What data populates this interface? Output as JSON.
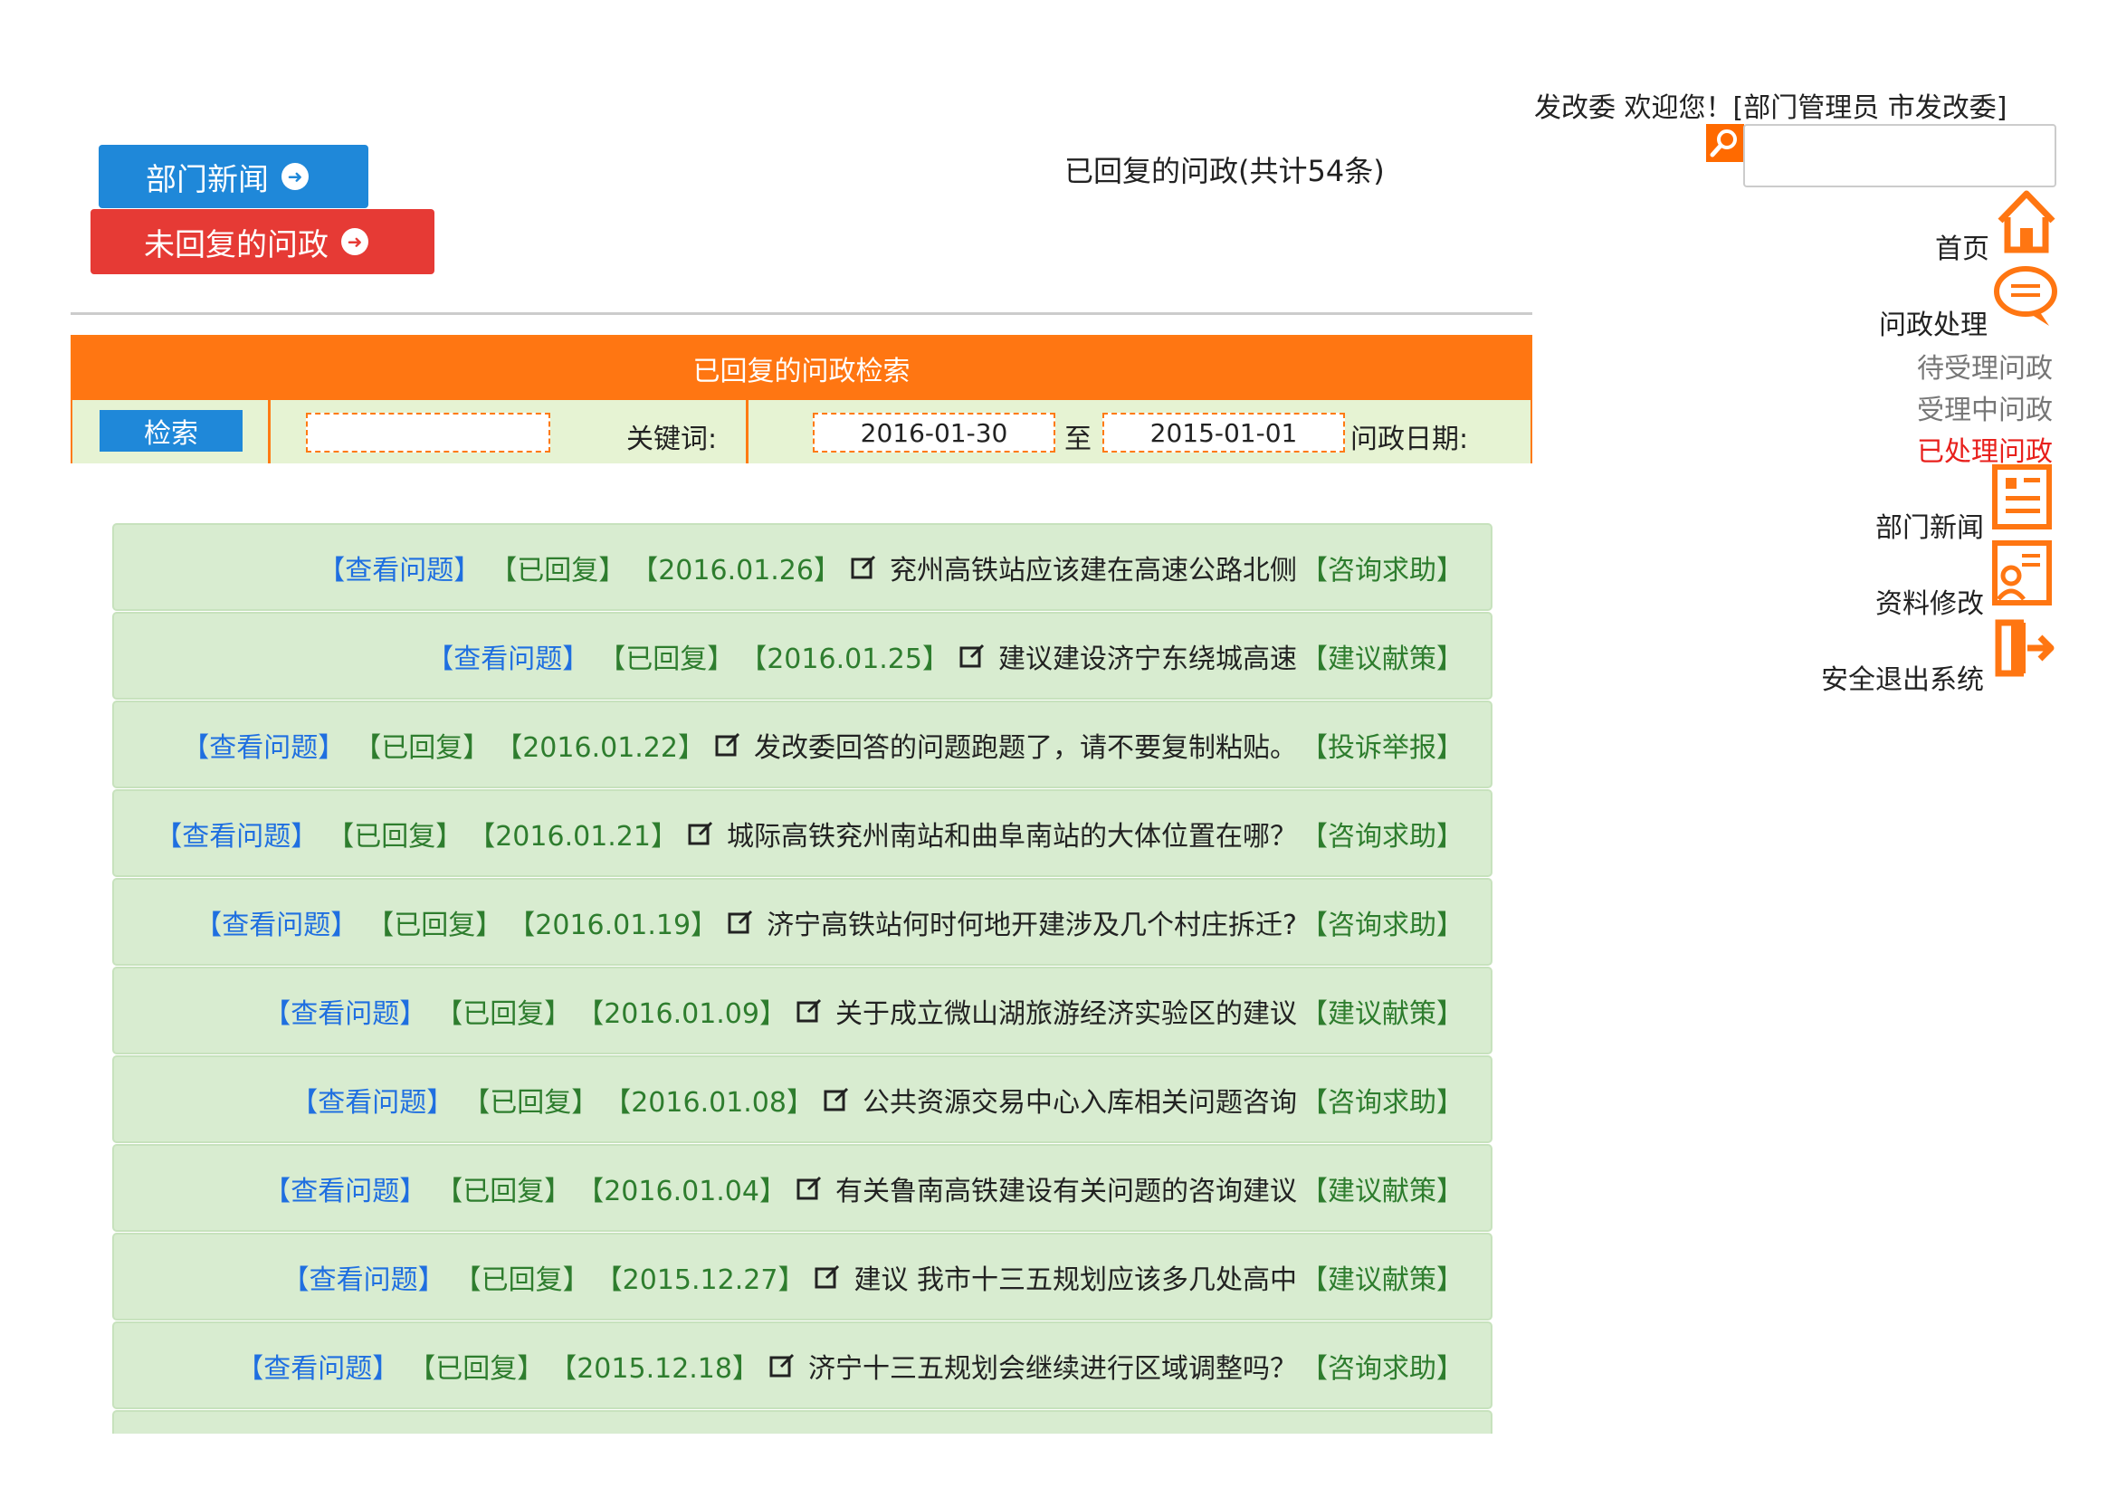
{
  "header": {
    "welcome": "发改委 欢迎您！[部门管理员 市发改委]",
    "search_placeholder": ""
  },
  "top_buttons": {
    "dept_news": "部门新闻",
    "unreplied": "未回复的问政"
  },
  "count_title": "已回复的问政(共计54条)",
  "panel": {
    "title": "已回复的问政检索",
    "date_label": "问政日期:",
    "date_from": "2015-01-01",
    "date_sep": "至",
    "date_to": "2016-01-30",
    "keyword_label": "关键词:",
    "keyword_value": "",
    "search_button": "检索"
  },
  "list": [
    {
      "category": "【咨询求助】",
      "title": "兖州高铁站应该建在高速公路北侧",
      "date": "【2016.01.26】",
      "status": "【已回复】",
      "action": "【查看问题】"
    },
    {
      "category": "【建议献策】",
      "title": "建议建设济宁东绕城高速",
      "date": "【2016.01.25】",
      "status": "【已回复】",
      "action": "【查看问题】"
    },
    {
      "category": "【投诉举报】",
      "title": "发改委回答的问题跑题了，请不要复制粘贴。",
      "date": "【2016.01.22】",
      "status": "【已回复】",
      "action": "【查看问题】"
    },
    {
      "category": "【咨询求助】",
      "title": "城际高铁兖州南站和曲阜南站的大体位置在哪？",
      "date": "【2016.01.21】",
      "status": "【已回复】",
      "action": "【查看问题】"
    },
    {
      "category": "【咨询求助】",
      "title": "济宁高铁站何时何地开建涉及几个村庄拆迁?",
      "date": "【2016.01.19】",
      "status": "【已回复】",
      "action": "【查看问题】"
    },
    {
      "category": "【建议献策】",
      "title": "关于成立微山湖旅游经济实验区的建议",
      "date": "【2016.01.09】",
      "status": "【已回复】",
      "action": "【查看问题】"
    },
    {
      "category": "【咨询求助】",
      "title": "公共资源交易中心入库相关问题咨询",
      "date": "【2016.01.08】",
      "status": "【已回复】",
      "action": "【查看问题】"
    },
    {
      "category": "【建议献策】",
      "title": "有关鲁南高铁建设有关问题的咨询建议",
      "date": "【2016.01.04】",
      "status": "【已回复】",
      "action": "【查看问题】"
    },
    {
      "category": "【建议献策】",
      "title": "建议 我市十三五规划应该多几处高中",
      "date": "【2015.12.27】",
      "status": "【已回复】",
      "action": "【查看问题】"
    },
    {
      "category": "【咨询求助】",
      "title": "济宁十三五规划会继续进行区域调整吗？",
      "date": "【2015.12.18】",
      "status": "【已回复】",
      "action": "【查看问题】"
    }
  ],
  "sidebar": {
    "home": "首页",
    "affairs": "问政处理",
    "pending": "待受理问政",
    "processing": "受理中问政",
    "done": "已处理问政",
    "news": "部门新闻",
    "profile": "资料修改",
    "logout": "安全退出系统"
  },
  "colors": {
    "accent_orange": "#ff7612",
    "blue": "#1f88d9",
    "red": "#e63a35",
    "row_green": "#d8ecd0",
    "active_red": "#e8201c"
  }
}
